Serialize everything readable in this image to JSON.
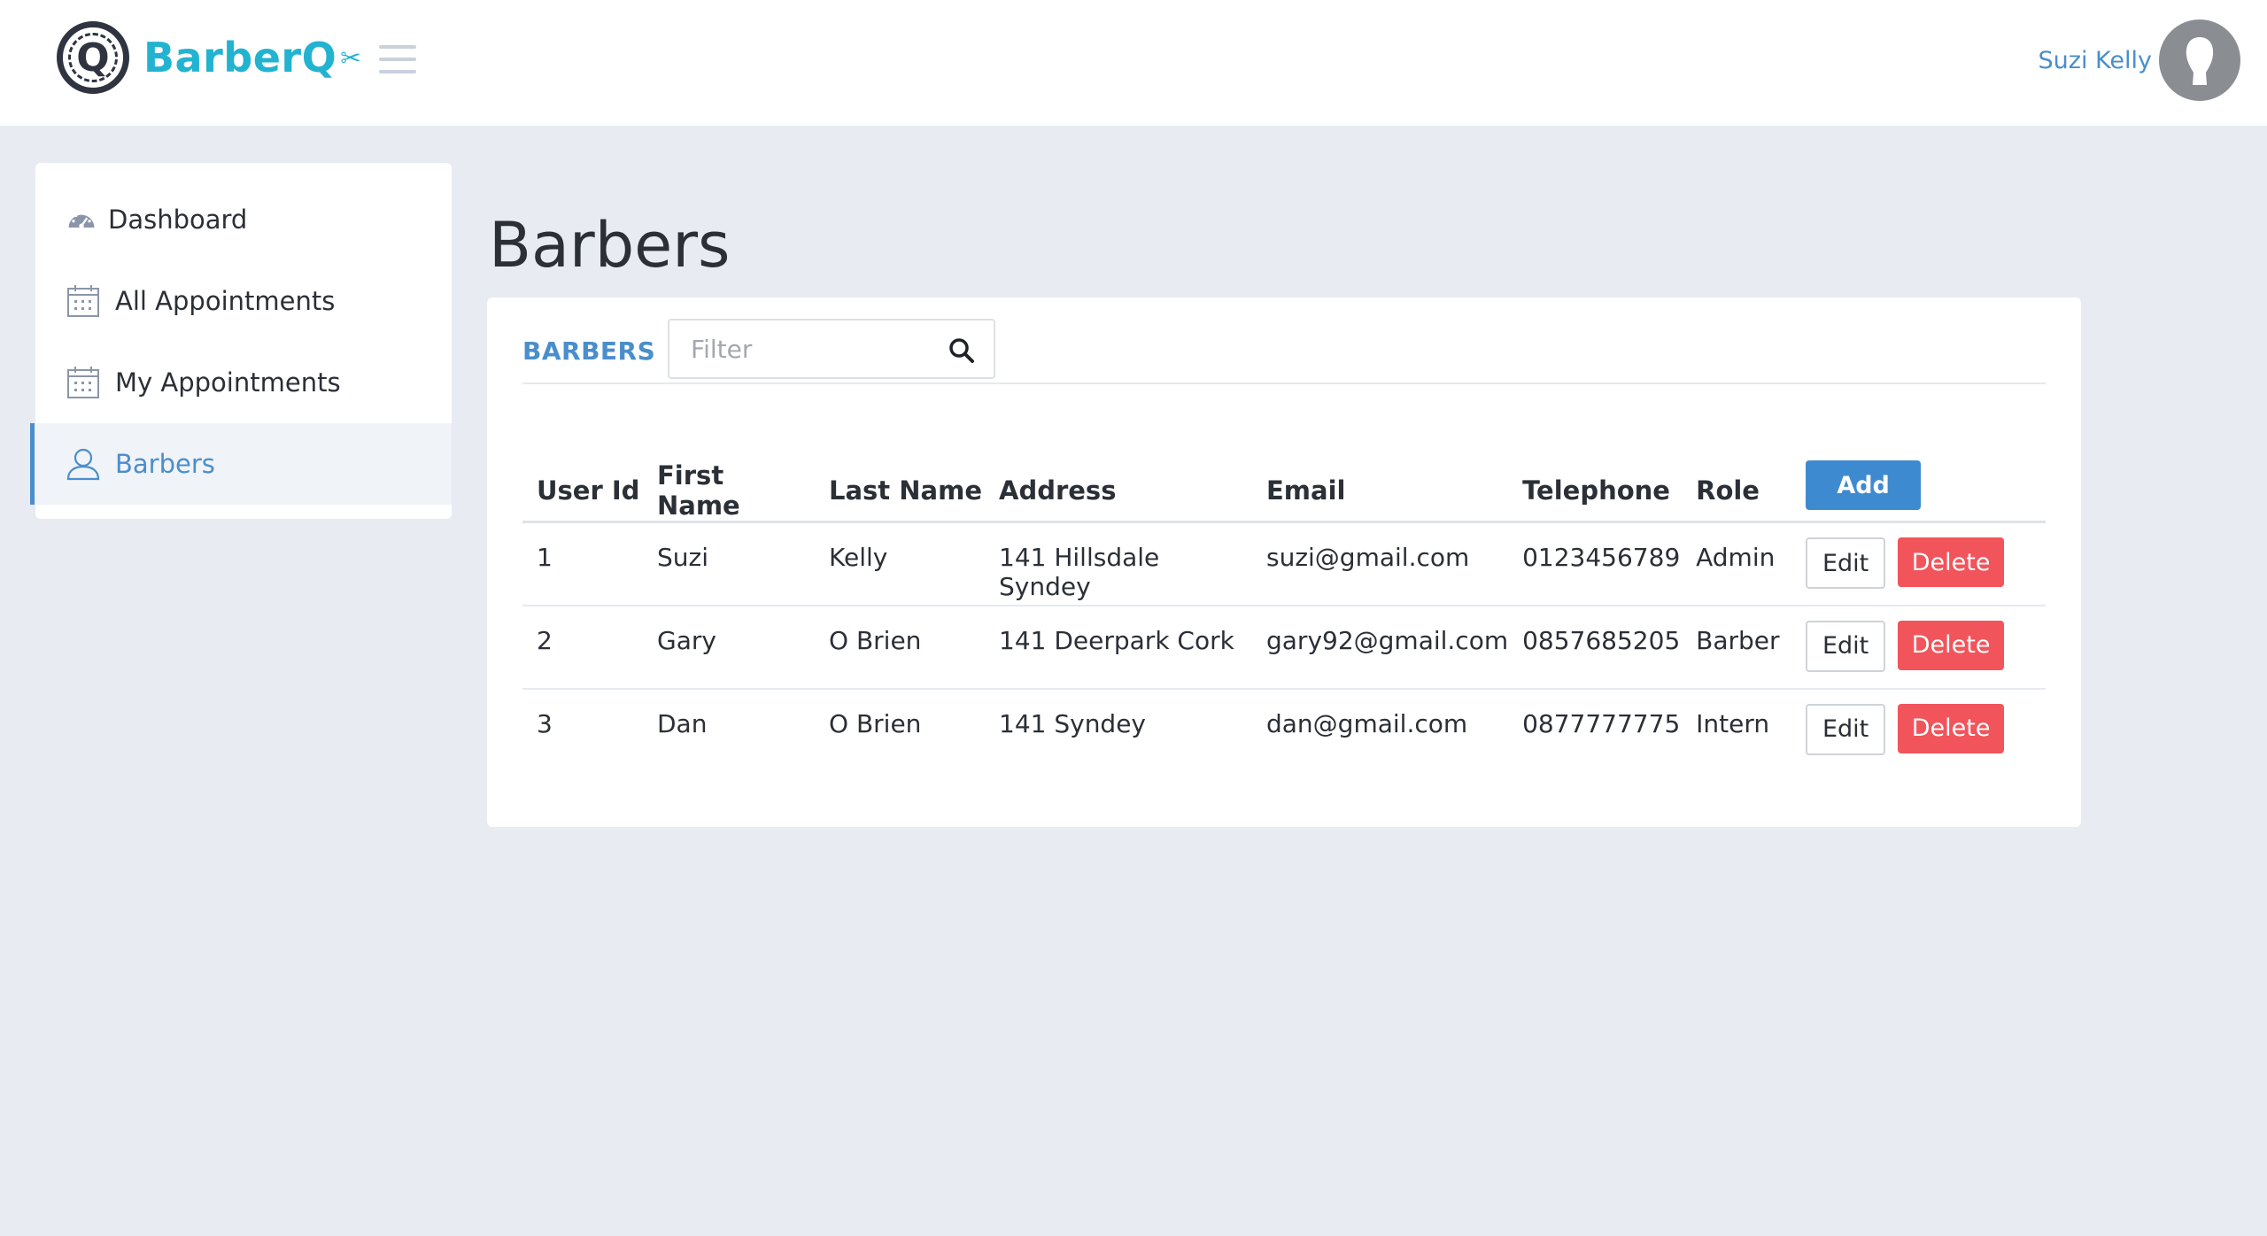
{
  "app": {
    "brand_name": "BarberQ",
    "brand_initial": "Q"
  },
  "header": {
    "user_name": "Suzi Kelly"
  },
  "sidebar": {
    "items": [
      {
        "label": "Dashboard",
        "icon": "dashboard-gauge-icon"
      },
      {
        "label": "All Appointments",
        "icon": "calendar-icon"
      },
      {
        "label": "My Appointments",
        "icon": "calendar-icon"
      },
      {
        "label": "Barbers",
        "icon": "user-icon",
        "active": true
      }
    ]
  },
  "main": {
    "page_title": "Barbers",
    "card_label": "BARBERS",
    "filter_placeholder": "Filter",
    "columns": [
      "User Id",
      "First Name",
      "Last Name",
      "Address",
      "Email",
      "Telephone",
      "Role"
    ],
    "add_label": "Add",
    "edit_label": "Edit",
    "delete_label": "Delete",
    "rows": [
      {
        "id": "1",
        "first": "Suzi",
        "last": "Kelly",
        "address": "141 Hillsdale Syndey",
        "email": "suzi@gmail.com",
        "phone": "0123456789",
        "role": "Admin"
      },
      {
        "id": "2",
        "first": "Gary",
        "last": "O Brien",
        "address": "141 Deerpark Cork",
        "email": "gary92@gmail.com",
        "phone": "0857685205",
        "role": "Barber"
      },
      {
        "id": "3",
        "first": "Dan",
        "last": "O Brien",
        "address": "141 Syndey",
        "email": "dan@gmail.com",
        "phone": "0877777775",
        "role": "Intern"
      }
    ]
  },
  "colors": {
    "brand": "#22b3d0",
    "accent": "#4a8ecb",
    "primary_button": "#3e8ad0",
    "danger_button": "#f2545b",
    "background": "#e8ebf2"
  }
}
